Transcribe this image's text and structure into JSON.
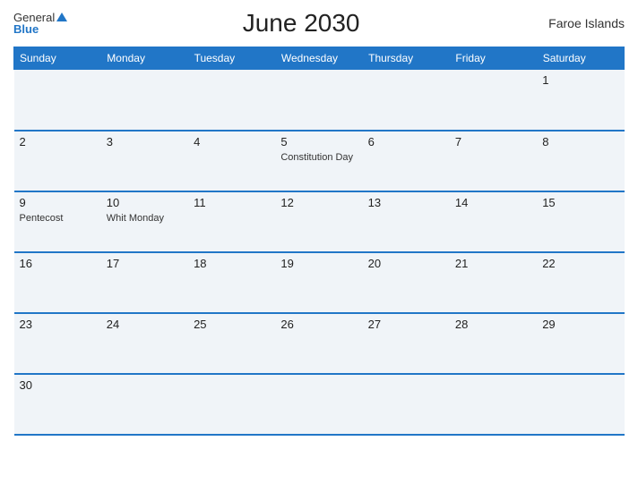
{
  "header": {
    "logo_general": "General",
    "logo_blue": "Blue",
    "title": "June 2030",
    "region": "Faroe Islands"
  },
  "weekdays": [
    "Sunday",
    "Monday",
    "Tuesday",
    "Wednesday",
    "Thursday",
    "Friday",
    "Saturday"
  ],
  "weeks": [
    [
      {
        "day": "",
        "event": ""
      },
      {
        "day": "",
        "event": ""
      },
      {
        "day": "",
        "event": ""
      },
      {
        "day": "",
        "event": ""
      },
      {
        "day": "",
        "event": ""
      },
      {
        "day": "",
        "event": ""
      },
      {
        "day": "1",
        "event": ""
      }
    ],
    [
      {
        "day": "2",
        "event": ""
      },
      {
        "day": "3",
        "event": ""
      },
      {
        "day": "4",
        "event": ""
      },
      {
        "day": "5",
        "event": "Constitution Day"
      },
      {
        "day": "6",
        "event": ""
      },
      {
        "day": "7",
        "event": ""
      },
      {
        "day": "8",
        "event": ""
      }
    ],
    [
      {
        "day": "9",
        "event": "Pentecost"
      },
      {
        "day": "10",
        "event": "Whit Monday"
      },
      {
        "day": "11",
        "event": ""
      },
      {
        "day": "12",
        "event": ""
      },
      {
        "day": "13",
        "event": ""
      },
      {
        "day": "14",
        "event": ""
      },
      {
        "day": "15",
        "event": ""
      }
    ],
    [
      {
        "day": "16",
        "event": ""
      },
      {
        "day": "17",
        "event": ""
      },
      {
        "day": "18",
        "event": ""
      },
      {
        "day": "19",
        "event": ""
      },
      {
        "day": "20",
        "event": ""
      },
      {
        "day": "21",
        "event": ""
      },
      {
        "day": "22",
        "event": ""
      }
    ],
    [
      {
        "day": "23",
        "event": ""
      },
      {
        "day": "24",
        "event": ""
      },
      {
        "day": "25",
        "event": ""
      },
      {
        "day": "26",
        "event": ""
      },
      {
        "day": "27",
        "event": ""
      },
      {
        "day": "28",
        "event": ""
      },
      {
        "day": "29",
        "event": ""
      }
    ],
    [
      {
        "day": "30",
        "event": ""
      },
      {
        "day": "",
        "event": ""
      },
      {
        "day": "",
        "event": ""
      },
      {
        "day": "",
        "event": ""
      },
      {
        "day": "",
        "event": ""
      },
      {
        "day": "",
        "event": ""
      },
      {
        "day": "",
        "event": ""
      }
    ]
  ]
}
